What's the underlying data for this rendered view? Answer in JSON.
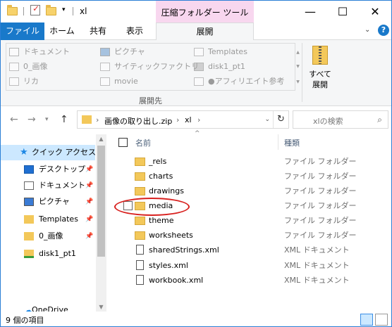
{
  "title_bar": {
    "title": "xl",
    "context_tab": "圧縮フォルダー ツール",
    "minimize": "—",
    "maximize": "☐",
    "close": "✕"
  },
  "ribbon_tabs": {
    "file": "ファイル",
    "home": "ホーム",
    "share": "共有",
    "view": "表示",
    "extract": "展開",
    "help": "?"
  },
  "ribbon": {
    "destinations": [
      {
        "label": "ドキュメント",
        "icon": "documents-icon"
      },
      {
        "label": "ピクチャ",
        "icon": "pictures-icon"
      },
      {
        "label": "Templates",
        "icon": "page-icon"
      },
      {
        "label": "0_画像",
        "icon": "page-icon"
      },
      {
        "label": "サイティックファクトリ",
        "icon": "page-icon"
      },
      {
        "label": "disk1_pt1",
        "icon": "drive-icon"
      },
      {
        "label": "リカ",
        "icon": "page-icon"
      },
      {
        "label": "movie",
        "icon": "page-icon"
      },
      {
        "label": "●アフィリエイト参考",
        "icon": "page-icon"
      }
    ],
    "group_label": "展開先",
    "extract_all_line1": "すべて",
    "extract_all_line2": "展開"
  },
  "address": {
    "crumbs": [
      "画像の取り出し.zip",
      "xl"
    ],
    "search_placeholder": "xlの検索"
  },
  "nav_pane": {
    "quick_access": "クイック アクセス",
    "items": [
      {
        "label": "デスクトップ",
        "pinned": true
      },
      {
        "label": "ドキュメント",
        "pinned": true
      },
      {
        "label": "ピクチャ",
        "pinned": true
      },
      {
        "label": "Templates",
        "pinned": true
      },
      {
        "label": "0_画像",
        "pinned": true
      },
      {
        "label": "disk1_pt1",
        "pinned": false
      }
    ],
    "onedrive": "OneDrive"
  },
  "file_list": {
    "col_name": "名前",
    "col_type": "種類",
    "rows": [
      {
        "name": "_rels",
        "type": "ファイル フォルダー",
        "kind": "folder"
      },
      {
        "name": "charts",
        "type": "ファイル フォルダー",
        "kind": "folder"
      },
      {
        "name": "drawings",
        "type": "ファイル フォルダー",
        "kind": "folder"
      },
      {
        "name": "media",
        "type": "ファイル フォルダー",
        "kind": "folder"
      },
      {
        "name": "theme",
        "type": "ファイル フォルダー",
        "kind": "folder"
      },
      {
        "name": "worksheets",
        "type": "ファイル フォルダー",
        "kind": "folder"
      },
      {
        "name": "sharedStrings.xml",
        "type": "XML ドキュメント",
        "kind": "xml"
      },
      {
        "name": "styles.xml",
        "type": "XML ドキュメント",
        "kind": "xml"
      },
      {
        "name": "workbook.xml",
        "type": "XML ドキュメント",
        "kind": "xml"
      }
    ]
  },
  "status_bar": {
    "item_count": "9 個の項目"
  },
  "colors": {
    "file_tab": "#1979ca",
    "context_tab": "#f8d7ef",
    "selection": "#cce8ff",
    "highlight_ellipse": "#d8201e"
  }
}
